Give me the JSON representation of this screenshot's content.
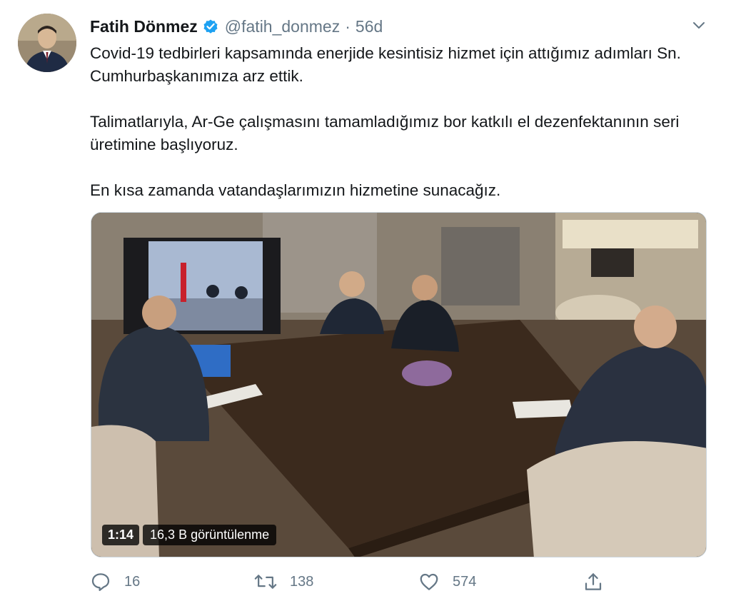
{
  "tweet": {
    "author": {
      "name": "Fatih Dönmez",
      "handle": "@fatih_donmez",
      "separator": "·",
      "time": "56d"
    },
    "paragraphs": [
      "Covid-19 tedbirleri kapsamında enerjide kesintisiz hizmet için attığımız adımları Sn. Cumhurbaşkanımıza arz ettik.",
      "Talimatlarıyla, Ar-Ge çalışmasını tamamladığımız bor katkılı el dezenfektanının seri üretimine başlıyoruz.",
      "En kısa zamanda vatandaşlarımızın hizmetine sunacağız."
    ],
    "video": {
      "duration": "1:14",
      "views": "16,3 B görüntülenme"
    },
    "actions": {
      "reply": {
        "icon": "reply-icon",
        "count": "16"
      },
      "retweet": {
        "icon": "retweet-icon",
        "count": "138"
      },
      "like": {
        "icon": "heart-icon",
        "count": "574"
      },
      "share": {
        "icon": "share-icon"
      }
    }
  },
  "colors": {
    "text": "#14171a",
    "secondary": "#657786",
    "verified": "#1da1f2",
    "border": "#ccd6dd"
  }
}
